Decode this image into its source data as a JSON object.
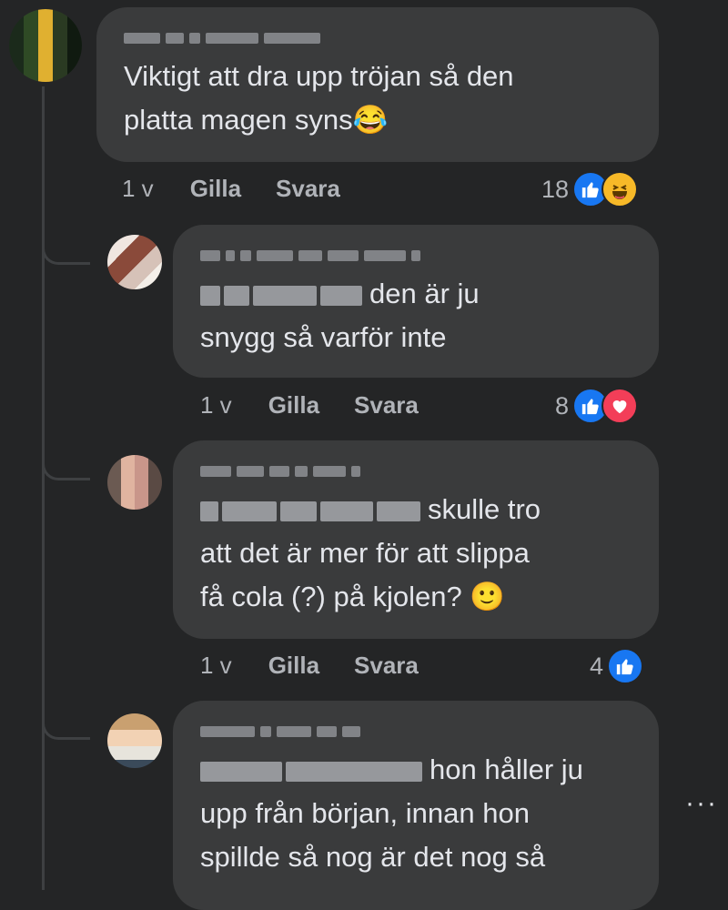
{
  "comments": [
    {
      "text": "Viktigt att dra upp tröjan så den\nplatta magen syns",
      "emoji": "😂",
      "time": "1 v",
      "like_label": "Gilla",
      "reply_label": "Svara",
      "reaction_count": "18",
      "reactions": [
        "like-icon",
        "haha-icon"
      ]
    },
    {
      "text_after_mention": "den är ju",
      "text_rest": "snygg så varför inte",
      "time": "1 v",
      "like_label": "Gilla",
      "reply_label": "Svara",
      "reaction_count": "8",
      "reactions": [
        "like-icon",
        "love-icon"
      ]
    },
    {
      "text_after_mention": "skulle tro",
      "text_rest": "att det är mer för att slippa\nfå cola (?) på kjolen?",
      "emoji": "🙂",
      "time": "1 v",
      "like_label": "Gilla",
      "reply_label": "Svara",
      "reaction_count": "4",
      "reactions": [
        "like-icon"
      ]
    },
    {
      "text_after_mention": "hon håller ju",
      "text_rest": "upp från början, innan hon\nspillde så nog är det nog så"
    }
  ],
  "more_label": "···",
  "colors": {
    "like": "#1877f2",
    "love": "#f33e58",
    "haha": "#f7b928",
    "bubble": "#3a3b3c",
    "background": "#242526"
  }
}
